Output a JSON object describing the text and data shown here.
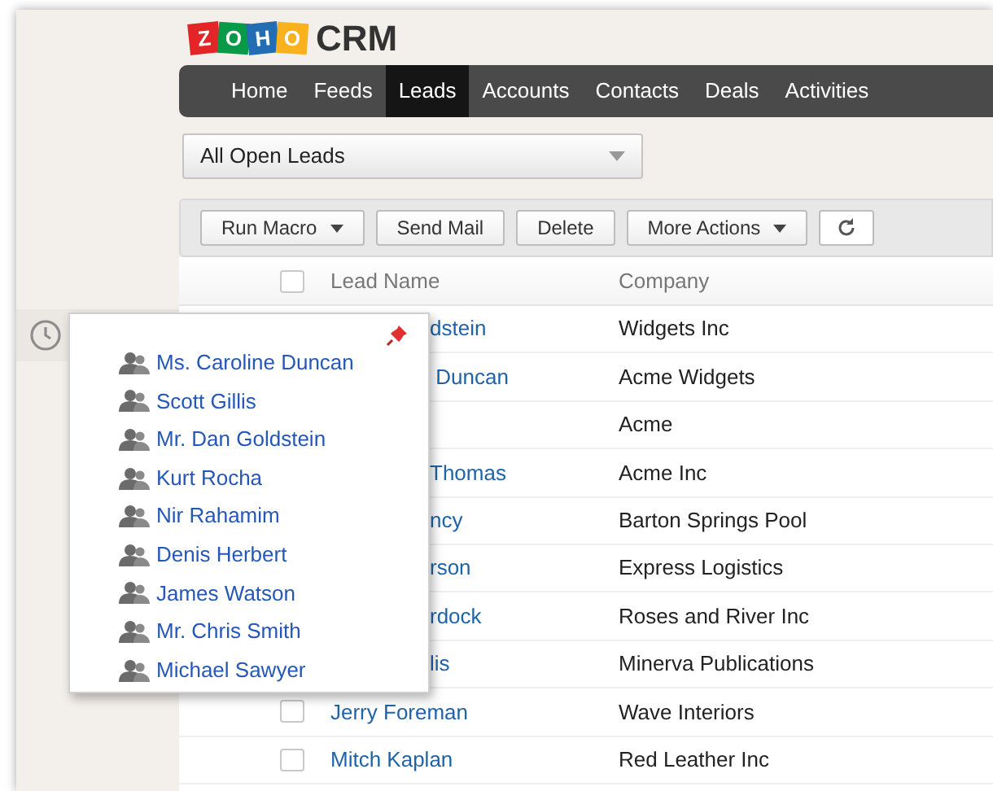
{
  "logo": {
    "letters": [
      "Z",
      "O",
      "H",
      "O"
    ],
    "product": "CRM"
  },
  "nav": [
    {
      "label": "Home",
      "selected": false
    },
    {
      "label": "Feeds",
      "selected": false
    },
    {
      "label": "Leads",
      "selected": true
    },
    {
      "label": "Accounts",
      "selected": false
    },
    {
      "label": "Contacts",
      "selected": false
    },
    {
      "label": "Deals",
      "selected": false
    },
    {
      "label": "Activities",
      "selected": false
    }
  ],
  "view_select": {
    "value": "All Open Leads"
  },
  "toolbar": [
    {
      "label": "Run Macro",
      "kind": "menu"
    },
    {
      "label": "Send Mail",
      "kind": "plain"
    },
    {
      "label": "Delete",
      "kind": "plain"
    },
    {
      "label": "More Actions",
      "kind": "menu"
    },
    {
      "kind": "refresh"
    }
  ],
  "table": {
    "select_all": {
      "checked": false
    },
    "columns": [
      "Lead Name",
      "Company"
    ],
    "rows": [
      {
        "kind": "partial",
        "lead_name": "dstein",
        "company": "Widgets Inc"
      },
      {
        "kind": "partial",
        "lead_name": " Duncan",
        "company": "Acme Widgets"
      },
      {
        "kind": "partial",
        "company": "Acme"
      },
      {
        "kind": "partial",
        "lead_name": "Thomas",
        "company": "Acme Inc"
      },
      {
        "kind": "partial",
        "lead_name": "ncy",
        "company": "Barton Springs Pool"
      },
      {
        "kind": "partial",
        "lead_name": "rson",
        "company": "Express Logistics"
      },
      {
        "kind": "partial",
        "lead_name": "rdock",
        "company": "Roses and River Inc"
      },
      {
        "kind": "partial",
        "lead_name": "lis",
        "company": "Minerva Publications"
      },
      {
        "kind": "full",
        "checked": false,
        "lead_name": "Jerry Foreman",
        "company": "Wave Interiors"
      },
      {
        "kind": "full",
        "checked": false,
        "lead_name": "Mitch Kaplan",
        "company": "Red Leather Inc"
      }
    ]
  },
  "recent_popup": {
    "pinned": true,
    "items": [
      "Ms. Caroline Duncan",
      "Scott Gillis",
      "Mr. Dan Goldstein",
      "Kurt Rocha",
      "Nir Rahamim",
      "Denis Herbert",
      "James Watson",
      "Mr. Chris Smith",
      "Michael Sawyer"
    ]
  }
}
